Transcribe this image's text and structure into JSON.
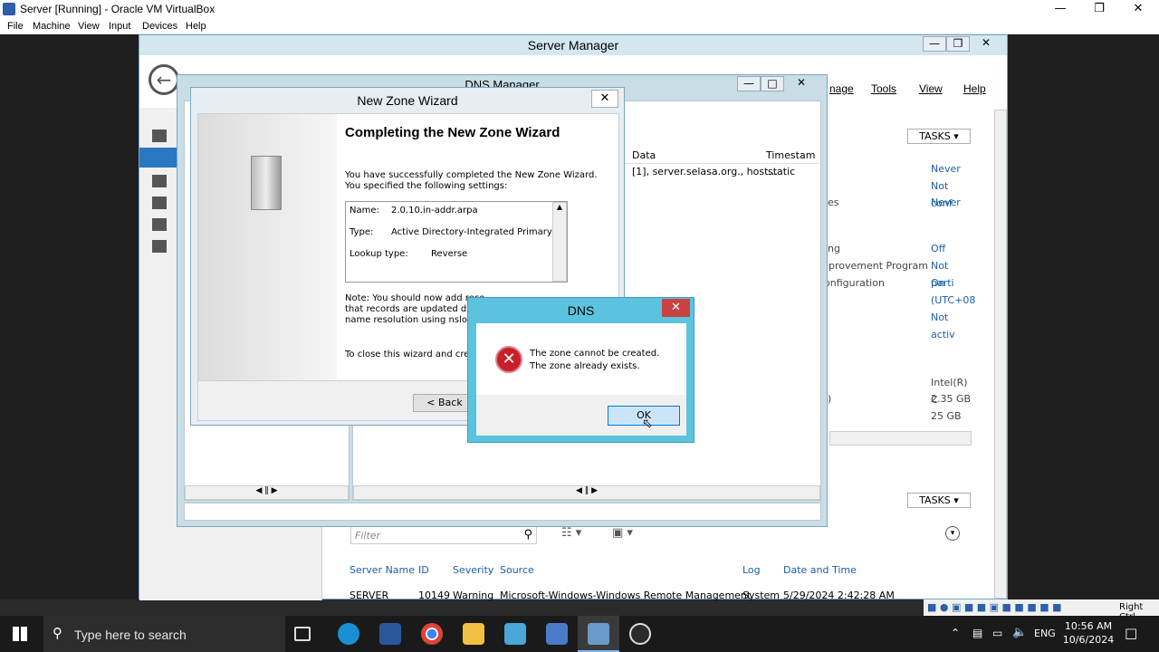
{
  "vbox": {
    "title": "Server [Running] - Oracle VM VirtualBox",
    "menu": [
      "File",
      "Machine",
      "View",
      "Input",
      "Devices",
      "Help"
    ],
    "status_label": "Right Ctrl"
  },
  "server_manager": {
    "title": "Server Manager",
    "menu": [
      "nage",
      "Tools",
      "View",
      "Help"
    ],
    "tasks_label": "TASKS",
    "properties_values": [
      "Never",
      "Not conf",
      "Never",
      "Off",
      "Not parti",
      "On",
      "(UTC+08",
      "Not activ",
      "Intel(R) C",
      "2.35 GB",
      "25 GB"
    ],
    "properties_labels": [
      "es",
      "ng",
      "nprovement Program",
      "onfiguration",
      ")"
    ],
    "filter_placeholder": "Filter",
    "events_headers": [
      "Server Name",
      "ID",
      "Severity",
      "Source",
      "Log",
      "Date and Time"
    ],
    "events_row": [
      "SERVER",
      "10149",
      "Warning",
      "Microsoft-Windows-Windows Remote Management",
      "System",
      "5/29/2024 2:42:28 AM"
    ]
  },
  "dns_manager": {
    "title": "DNS Manager",
    "col_data": "Data",
    "col_timestamp": "Timestam",
    "row_data": "[1], server.selasa.org., host...",
    "row_timestamp": "static"
  },
  "wizard": {
    "title": "New Zone Wizard",
    "heading": "Completing the New Zone Wizard",
    "intro": "You have successfully completed the New Zone Wizard. You specified the following settings:",
    "settings": [
      {
        "label": "Name:",
        "value": "2.0.10.in-addr.arpa"
      },
      {
        "label": "Type:",
        "value": "Active Directory-Integrated Primary"
      },
      {
        "label": "Lookup type:",
        "value": "Reverse"
      }
    ],
    "note_lines": [
      "Note: You should now add reco",
      "that records are updated dyna",
      "name resolution using nslookup"
    ],
    "close_text": "To close this wizard and create",
    "back_label": "< Back"
  },
  "dns_dialog": {
    "title": "DNS",
    "message_line1": "The zone cannot be created.",
    "message_line2": "The zone already exists.",
    "ok_label": "OK"
  },
  "taskbar": {
    "search_placeholder": "Type here to search",
    "lang": "ENG",
    "time": "10:56 AM",
    "date": "10/6/2024"
  }
}
